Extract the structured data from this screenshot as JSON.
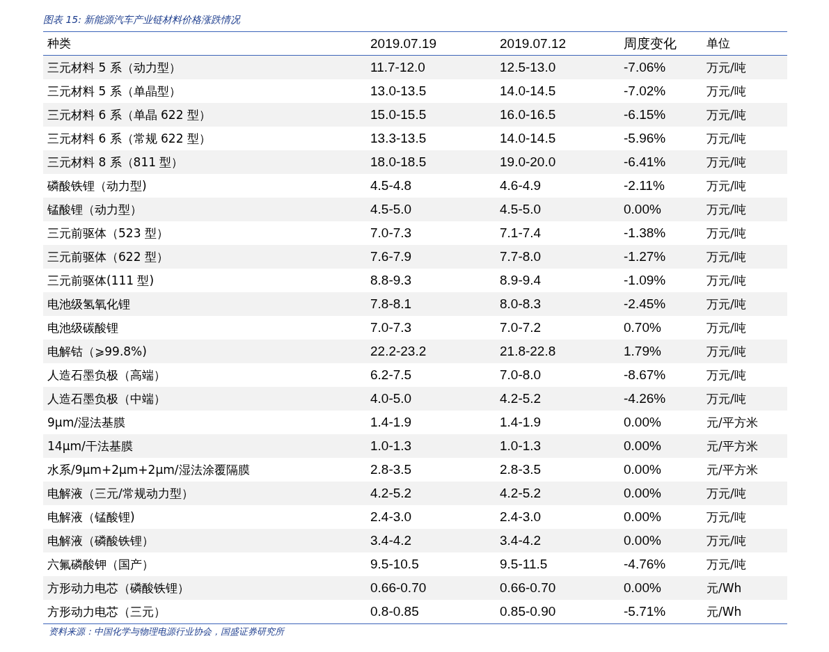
{
  "title": "图表 15: 新能源汽车产业链材料价格涨跌情况",
  "table": {
    "columns": [
      "种类",
      "2019.07.19",
      "2019.07.12",
      "周度变化",
      "单位"
    ],
    "rows": [
      [
        "三元材料 5 系（动力型）",
        "11.7-12.0",
        "12.5-13.0",
        "-7.06%",
        "万元/吨"
      ],
      [
        "三元材料 5 系（单晶型）",
        "13.0-13.5",
        "14.0-14.5",
        "-7.02%",
        "万元/吨"
      ],
      [
        "三元材料 6 系（单晶 622 型）",
        "15.0-15.5",
        "16.0-16.5",
        "-6.15%",
        "万元/吨"
      ],
      [
        "三元材料 6 系（常规 622 型）",
        "13.3-13.5",
        "14.0-14.5",
        "-5.96%",
        "万元/吨"
      ],
      [
        "三元材料 8 系（811 型）",
        "18.0-18.5",
        "19.0-20.0",
        "-6.41%",
        "万元/吨"
      ],
      [
        "磷酸铁锂（动力型)",
        "4.5-4.8",
        "4.6-4.9",
        "-2.11%",
        "万元/吨"
      ],
      [
        "锰酸锂（动力型）",
        "4.5-5.0",
        "4.5-5.0",
        "0.00%",
        "万元/吨"
      ],
      [
        "三元前驱体（523 型）",
        "7.0-7.3",
        "7.1-7.4",
        "-1.38%",
        "万元/吨"
      ],
      [
        "三元前驱体（622 型）",
        "7.6-7.9",
        "7.7-8.0",
        "-1.27%",
        "万元/吨"
      ],
      [
        "三元前驱体(111 型)",
        "8.8-9.3",
        "8.9-9.4",
        "-1.09%",
        "万元/吨"
      ],
      [
        "电池级氢氧化锂",
        "7.8-8.1",
        "8.0-8.3",
        "-2.45%",
        "万元/吨"
      ],
      [
        "电池级碳酸锂",
        "7.0-7.3",
        "7.0-7.2",
        "0.70%",
        "万元/吨"
      ],
      [
        "电解钴（⩾99.8%)",
        "22.2-23.2",
        "21.8-22.8",
        "1.79%",
        "万元/吨"
      ],
      [
        "人造石墨负极（高端）",
        "6.2-7.5",
        "7.0-8.0",
        "-8.67%",
        "万元/吨"
      ],
      [
        "人造石墨负极（中端）",
        "4.0-5.0",
        "4.2-5.2",
        "-4.26%",
        "万元/吨"
      ],
      [
        "9μm/湿法基膜",
        "1.4-1.9",
        "1.4-1.9",
        "0.00%",
        "元/平方米"
      ],
      [
        "14μm/干法基膜",
        "1.0-1.3",
        "1.0-1.3",
        "0.00%",
        "元/平方米"
      ],
      [
        "水系/9μm+2μm+2μm/湿法涂覆隔膜",
        "2.8-3.5",
        "2.8-3.5",
        "0.00%",
        "元/平方米"
      ],
      [
        "电解液（三元/常规动力型）",
        "4.2-5.2",
        "4.2-5.2",
        "0.00%",
        "万元/吨"
      ],
      [
        "电解液（锰酸锂)",
        "2.4-3.0",
        "2.4-3.0",
        "0.00%",
        "万元/吨"
      ],
      [
        "电解液（磷酸铁锂）",
        "3.4-4.2",
        "3.4-4.2",
        "0.00%",
        "万元/吨"
      ],
      [
        "六氟磷酸钾（国产）",
        "9.5-10.5",
        "9.5-11.5",
        "-4.76%",
        "万元/吨"
      ],
      [
        "方形动力电芯（磷酸铁锂）",
        "0.66-0.70",
        "0.66-0.70",
        "0.00%",
        "元/Wh"
      ],
      [
        "方形动力电芯（三元）",
        "0.8-0.85",
        "0.85-0.90",
        "-5.71%",
        "元/Wh"
      ]
    ]
  },
  "source": "资料来源：中国化学与物理电源行业协会，国盛证券研究所"
}
